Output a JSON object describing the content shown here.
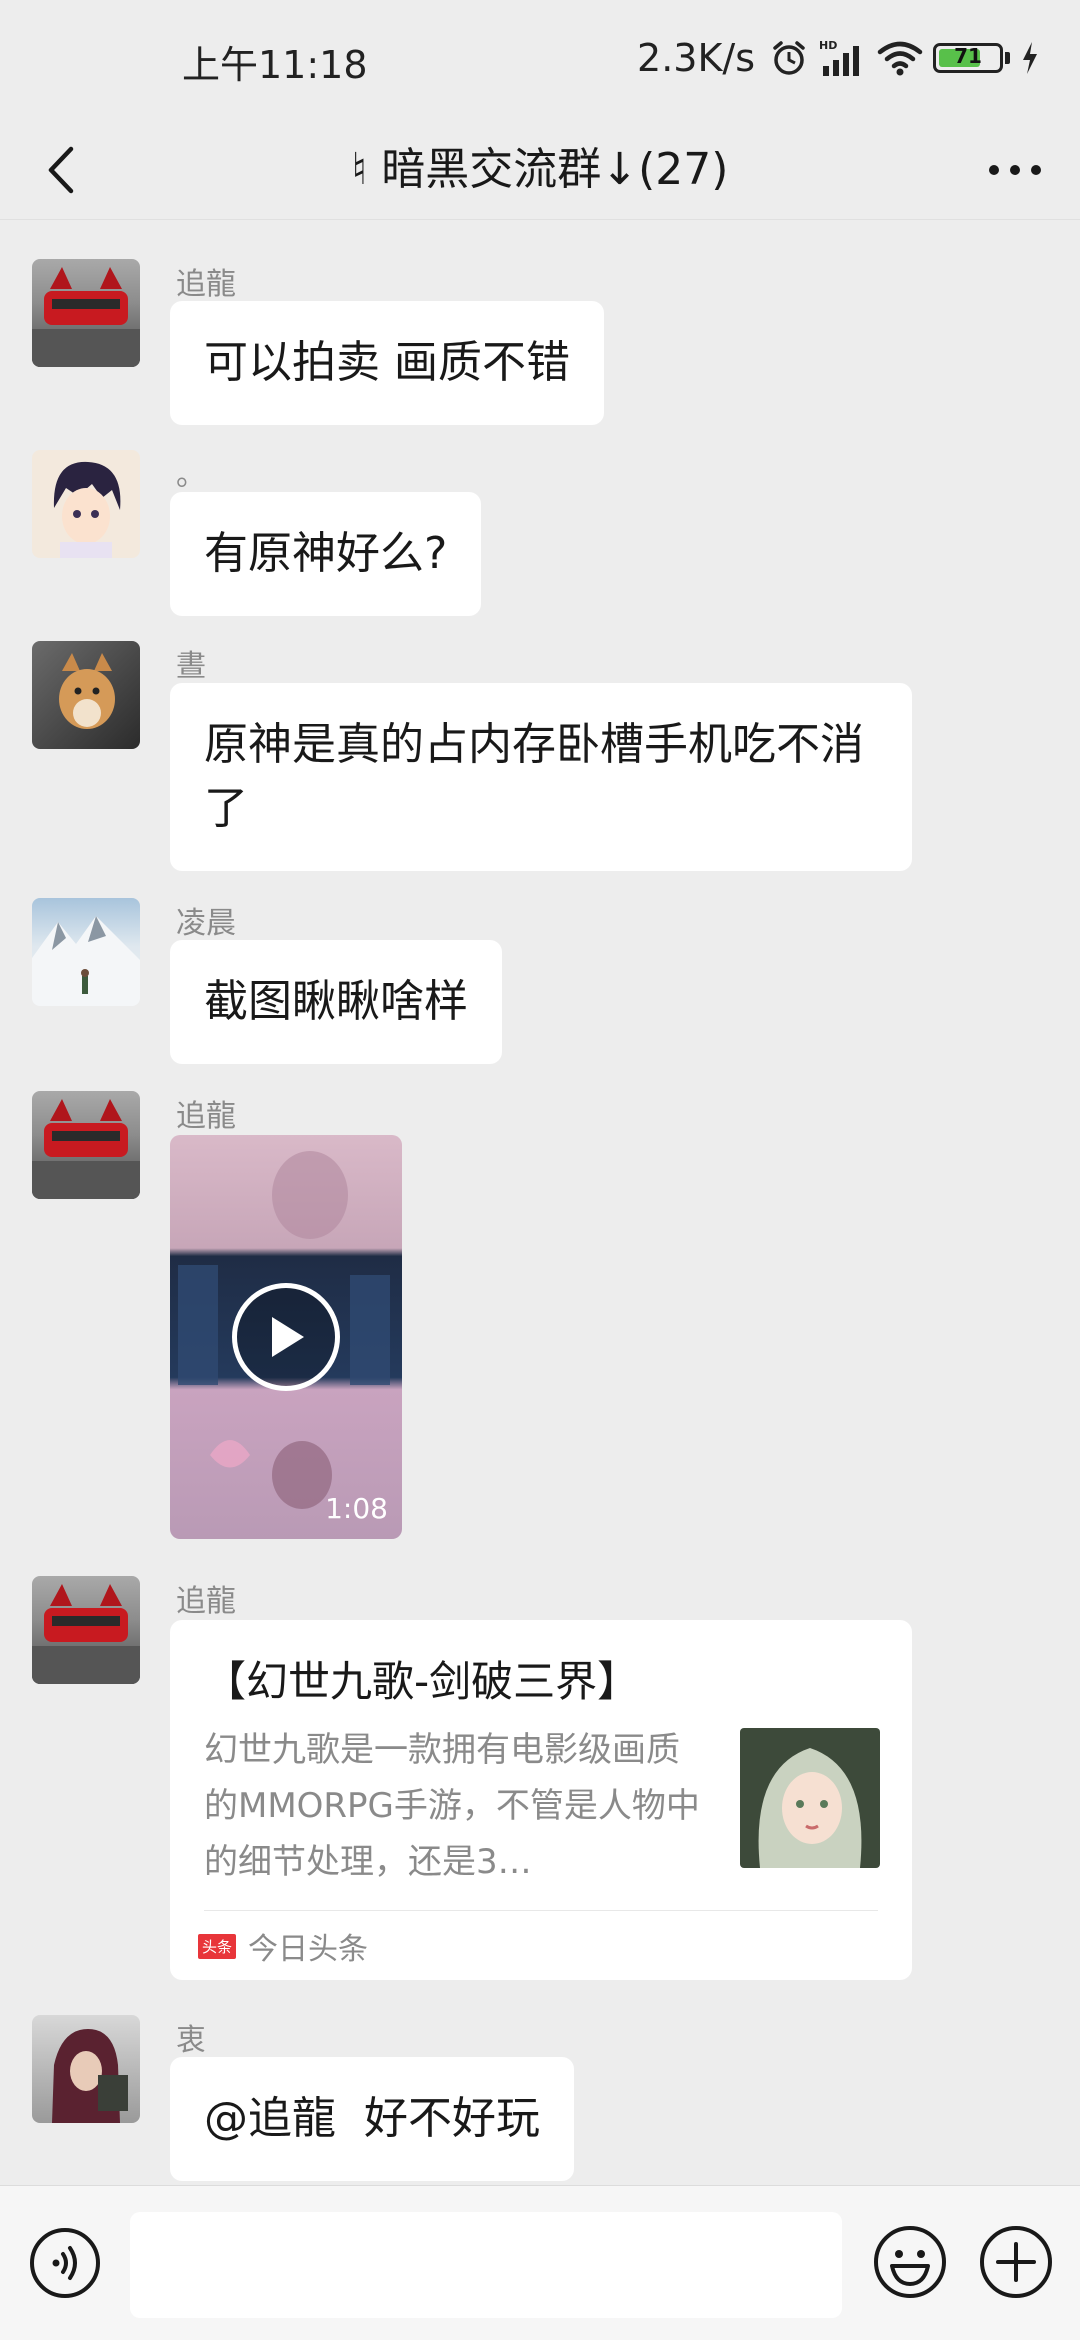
{
  "status_bar": {
    "time": "上午11:18",
    "net_speed": "2.3K/s",
    "battery": "71"
  },
  "header": {
    "title": "♮ 暗黑交流群↓(27)"
  },
  "messages": [
    {
      "sender": "追龍",
      "text": "可以拍卖 画质不错"
    },
    {
      "sender": "。",
      "text": "有原神好么?"
    },
    {
      "sender": "晝",
      "text": "原神是真的占内存卧槽手机吃不消了"
    },
    {
      "sender": "凌晨",
      "text": "截图瞅瞅啥样"
    },
    {
      "sender": "追龍",
      "video_duration": "1:08"
    },
    {
      "sender": "追龍",
      "card": {
        "title": "【幻世九歌-剑破三界】",
        "description": "幻世九歌是一款拥有电影级画质的MMORPG手游，不管是人物中的细节处理，还是3…",
        "source": "今日头条",
        "source_badge": "头条"
      }
    },
    {
      "sender": "衷",
      "text": "@追龍  好不好玩"
    }
  ],
  "input_bar": {
    "placeholder": ""
  },
  "colors": {
    "background": "#ededed",
    "bubble": "#ffffff",
    "battery_green": "#58c04a"
  }
}
